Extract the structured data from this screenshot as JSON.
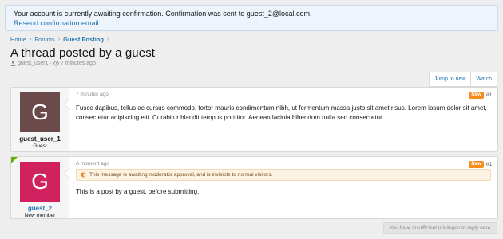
{
  "notice": {
    "message": "Your account is currently awaiting confirmation. Confirmation was sent to guest_2@local.com.",
    "link": "Resend confirmation email"
  },
  "breadcrumb": [
    "Home",
    "Forums",
    "Guest Posting"
  ],
  "thread": {
    "title": "A thread posted by a guest",
    "author": "guest_user1",
    "time": "7 minutes ago"
  },
  "actions": {
    "jump_label": "Jump to new",
    "watch_label": "Watch"
  },
  "posts": [
    {
      "avatar_letter": "G",
      "avatar_color": "#6b4a4a",
      "username": "guest_user_1",
      "user_title": "Guest",
      "time": "7 minutes ago",
      "badge": "New",
      "number": "#1",
      "body": "Fusce dapibus, tellus ac cursus commodo, tortor mauris condimentum nibh, ut fermentum massa justo sit amet risus. Lorem ipsum dolor sit amet, consectetur adipiscing elit. Curabitur blandit tempus porttitor. Aenean lacinia bibendum nulla sed consectetur."
    },
    {
      "avatar_letter": "G",
      "avatar_color": "#d0225f",
      "username": "guest_2",
      "user_title": "New member",
      "time": "A moment ago",
      "badge": "New",
      "number": "#1",
      "moderation": "This message is awaiting moderator approval, and is invisible to normal visitors.",
      "body": "This is a post by a guest, before submitting."
    }
  ],
  "footer": {
    "privilege_note": "You have insufficient privileges to reply here."
  },
  "colors": {
    "link": "#2577b1",
    "new_badge": "#f78c1f",
    "online_indicator": "#63b103"
  }
}
